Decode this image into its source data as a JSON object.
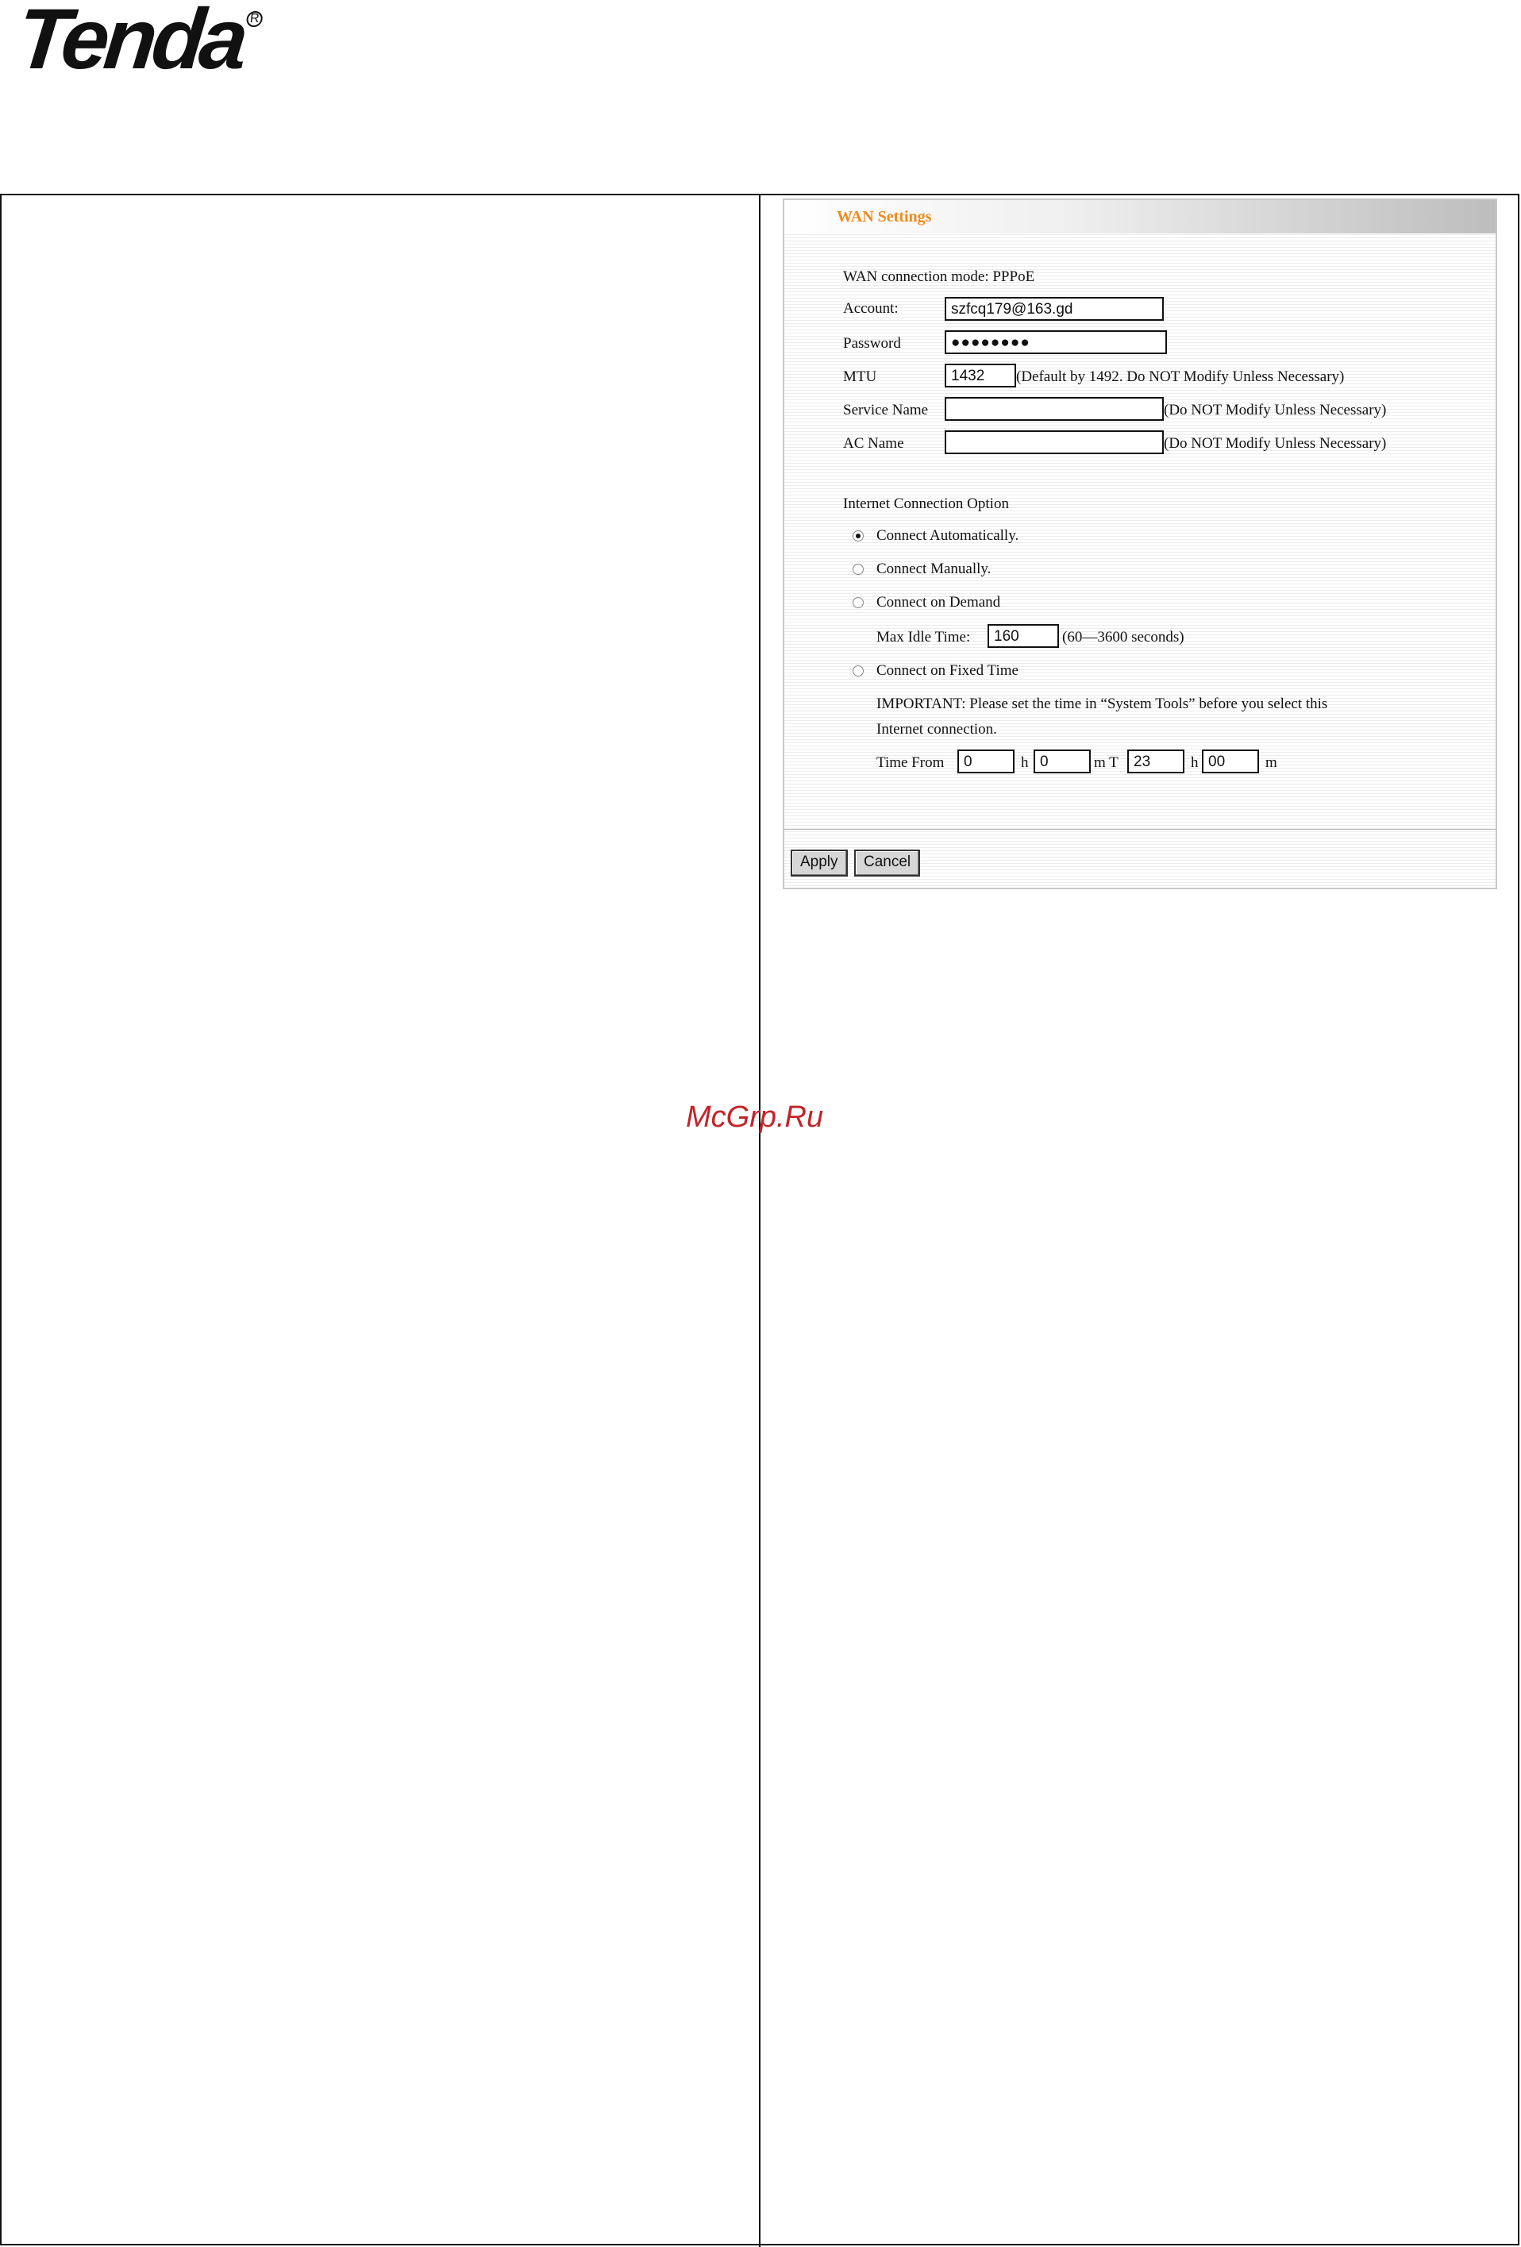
{
  "logo": {
    "text": "Tenda",
    "reg": "R"
  },
  "wan": {
    "title": "WAN Settings",
    "mode_label": "WAN connection mode: PPPoE",
    "account_label": "Account:",
    "account_value": "szfcq179@163.gd",
    "password_label": "Password",
    "password_value": "●●●●●●●●",
    "mtu_label": "MTU",
    "mtu_value": "1432",
    "mtu_hint": "(Default by 1492. Do NOT Modify Unless Necessary)",
    "service_label": "Service Name",
    "service_value": "",
    "service_hint": "(Do NOT Modify Unless Necessary)",
    "ac_label": "AC Name",
    "ac_value": "",
    "ac_hint": "(Do NOT Modify Unless Necessary)",
    "option_heading": "Internet Connection Option",
    "opt_auto": "Connect Automatically.",
    "opt_manual": "Connect Manually.",
    "opt_demand": "Connect on Demand",
    "idle_label": "Max Idle Time:",
    "idle_value": "160",
    "idle_hint": "(60—3600 seconds)",
    "opt_fixed": "Connect on Fixed Time",
    "important_line1": "IMPORTANT: Please set the time in “System Tools” before you select this",
    "important_line2": "Internet connection.",
    "time_from_label": "Time From",
    "time_h1": "0",
    "h_label1": "h",
    "time_m1": "0",
    "m_to_label": "m T",
    "time_h2": "23",
    "h_label2": "h",
    "time_m2": "00",
    "m_label2": "m",
    "apply_label": "Apply",
    "cancel_label": "Cancel"
  },
  "watermark": "McGrp.Ru"
}
